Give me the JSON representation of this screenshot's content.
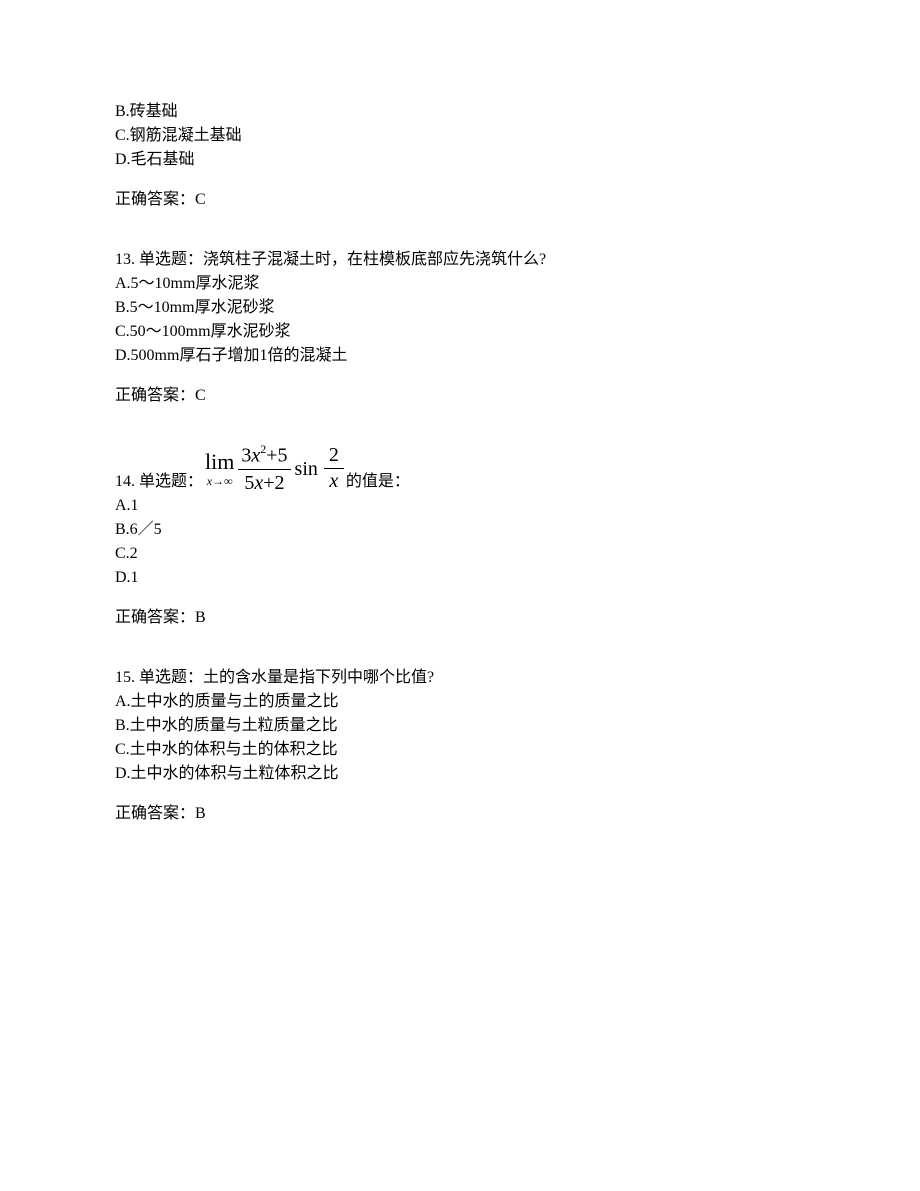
{
  "partialQuestionTop": {
    "options": [
      "B.砖基础",
      "C.钢筋混凝土基础",
      "D.毛石基础"
    ],
    "answerLabel": "正确答案：C"
  },
  "q13": {
    "stem": "13. 单选题：浇筑柱子混凝土时，在柱模板底部应先浇筑什么?",
    "options": [
      "A.5～10mm厚水泥浆",
      "B.5～10mm厚水泥砂浆",
      "C.50～100mm厚水泥砂浆",
      "D.500mm厚石子增加1倍的混凝土"
    ],
    "answerLabel": "正确答案：C"
  },
  "q14": {
    "prefix": "14. 单选题：",
    "math": {
      "limTop": "lim",
      "limBot": "x→∞",
      "frac1Num": "3x²+5",
      "frac1Den": "5x+2",
      "sin": "sin",
      "frac2Num": "2",
      "frac2Den": "x"
    },
    "suffix": "的值是：",
    "options": [
      "A.1",
      "B.6／5",
      "C.2",
      "D.1"
    ],
    "answerLabel": "正确答案：B"
  },
  "q15": {
    "stem": "15. 单选题：土的含水量是指下列中哪个比值?",
    "options": [
      "A.土中水的质量与土的质量之比",
      "B.土中水的质量与土粒质量之比",
      "C.土中水的体积与土的体积之比",
      "D.土中水的体积与土粒体积之比"
    ],
    "answerLabel": "正确答案：B"
  }
}
